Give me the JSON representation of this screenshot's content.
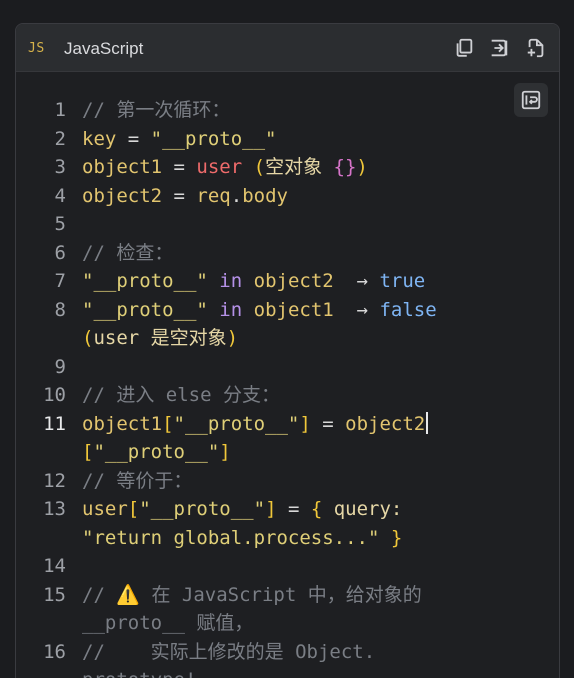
{
  "header": {
    "lang_icon": "JS",
    "language": "JavaScript",
    "buttons": [
      "copy-icon",
      "insert-icon",
      "new-file-icon"
    ]
  },
  "toolbar": {
    "wrap_icon": "word-wrap-icon"
  },
  "lines": [
    {
      "n": "1",
      "parts": [
        "// 第一次循环："
      ]
    },
    {
      "n": "2",
      "parts": [
        "key",
        " = ",
        "\"__proto__\""
      ]
    },
    {
      "n": "3",
      "parts": [
        "object1",
        " = ",
        "user",
        " ",
        "(",
        "空对象 ",
        "{}",
        ")"
      ]
    },
    {
      "n": "4",
      "parts": [
        "object2",
        " = ",
        "req",
        ".",
        "body"
      ]
    },
    {
      "n": "5",
      "parts": []
    },
    {
      "n": "6",
      "parts": [
        "// 检查："
      ]
    },
    {
      "n": "7",
      "parts": [
        "\"__proto__\"",
        " ",
        "in",
        " ",
        "object2",
        "  → ",
        "true"
      ]
    },
    {
      "n": "8",
      "parts": [
        "\"__proto__\"",
        " ",
        "in",
        " ",
        "object1",
        "  → ",
        "false"
      ]
    },
    {
      "n": "",
      "parts": [
        "(",
        "user 是空对象",
        ")"
      ]
    },
    {
      "n": "9",
      "parts": []
    },
    {
      "n": "10",
      "parts": [
        "// 进入 else 分支："
      ]
    },
    {
      "n": "11",
      "parts": [
        "object1",
        "[",
        "\"__proto__\"",
        "]",
        " = ",
        "object2"
      ]
    },
    {
      "n": "",
      "parts": [
        "[",
        "\"__proto__\"",
        "]"
      ]
    },
    {
      "n": "12",
      "parts": [
        "// 等价于："
      ]
    },
    {
      "n": "13",
      "parts": [
        "user",
        "[",
        "\"__proto__\"",
        "]",
        " = ",
        "{",
        " query:"
      ]
    },
    {
      "n": "",
      "parts": [
        "\"return global.process...\"",
        " ",
        "}"
      ]
    },
    {
      "n": "14",
      "parts": []
    },
    {
      "n": "15",
      "parts": [
        "// ",
        "⚠️",
        " 在 JavaScript 中，给对象的"
      ]
    },
    {
      "n": "",
      "parts": [
        "__proto__ 赋值，"
      ]
    },
    {
      "n": "16",
      "parts": [
        "//    实际上修改的是 Object."
      ]
    },
    {
      "n": "",
      "parts": [
        "prototype!"
      ]
    }
  ]
}
